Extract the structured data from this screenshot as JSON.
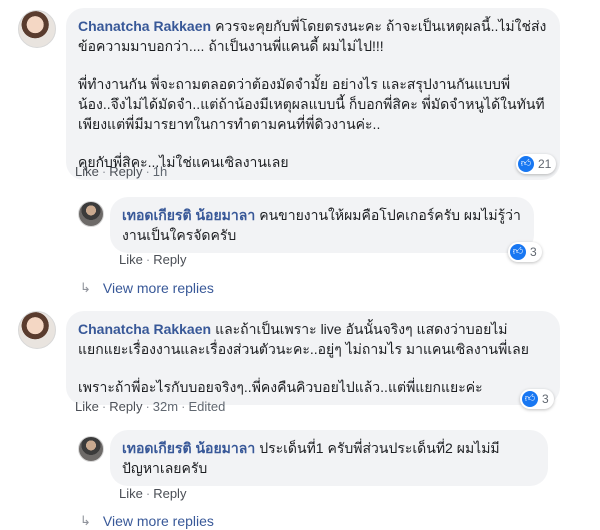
{
  "comments": [
    {
      "author": "Chanatcha Rakkaen",
      "paragraphs": [
        "ควรจะคุยกับพี่โดยตรงนะคะ ถ้าจะเป็นเหตุผลนี้..ไม่ใช่ส่งข้อความมาบอกว่า.... ถ้าเป็นงานพี่แคนดี้ ผมไม่ไป!!!",
        "พี่ทำงานกัน พี่จะถามตลอดว่าต้องมัดจำมั้ย อย่างไร และสรุปงานกันแบบพี่น้อง..จึงไม่ได้มัดจำ..แต่ถ้าน้องมีเหตุผลแบบนี้ ก็บอกพี่สิคะ พี่มัดจำหนูได้ในทันที เพียงแต่พี่มีมารยาทในการทำตามคนที่พี่ดิวงานค่ะ..",
        "คุยกับพี่สิคะ...ไม่ใช่แคนเซิลงานเลย"
      ],
      "reactions": "21",
      "actions": {
        "like": "Like",
        "reply": "Reply",
        "time": "1h"
      },
      "reply": {
        "author": "เทอดเกียรติ น้อยมาลา",
        "text": "คนขายงานให้ผมคือโปคเกอร์ครับ ผมไม่รู้ว่างานเป็นใครจัดครับ",
        "reactions": "3",
        "actions": {
          "like": "Like",
          "reply": "Reply"
        }
      },
      "view_more": "View more replies"
    },
    {
      "author": "Chanatcha Rakkaen",
      "paragraphs": [
        "และถ้าเป็นเพราะ live อันนั้นจริงๆ แสดงว่าบอยไม่แยกแยะเรื่องงานและเรื่องส่วนตัวนะคะ..อยู่ๆ ไม่ถามไร มาแคนเซิลงานพี่เลย",
        "เพราะถ้าพี่อะไรกับบอยจริงๆ..พี่คงคืนคิวบอยไปแล้ว..แต่พี่แยกแยะค่ะ"
      ],
      "reactions": "3",
      "actions": {
        "like": "Like",
        "reply": "Reply",
        "time": "32m",
        "edited": "Edited"
      },
      "reply": {
        "author": "เทอดเกียรติ น้อยมาลา",
        "text": "ประเด็นที่1 ครับพี่ส่วนประเด็นที่2 ผมไม่มีปัญหาเลยครับ",
        "actions": {
          "like": "Like",
          "reply": "Reply"
        }
      },
      "view_more": "View more replies"
    }
  ],
  "colors": {
    "link": "#385898",
    "bubble": "#f2f3f5",
    "like": "#1877f2"
  },
  "icons": {
    "like": "thumbs-up-icon",
    "expand": "reply-arrow-icon"
  }
}
